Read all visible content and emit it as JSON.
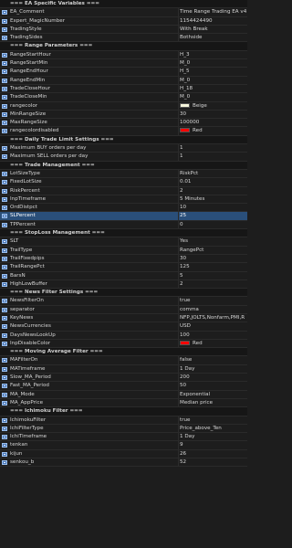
{
  "colors": {
    "beige": "#f5f5dc",
    "red": "#ff0000"
  },
  "rows": [
    {
      "type": "section",
      "name": "=== EA Specific Variables ===",
      "value": ""
    },
    {
      "type": "param",
      "name": "EA_Comment",
      "value": "Time Range Trading EA v4"
    },
    {
      "type": "param",
      "name": "Expert_MagicNumber",
      "value": "1154424490"
    },
    {
      "type": "param",
      "name": "TradingStyle",
      "value": "With Break"
    },
    {
      "type": "param",
      "name": "TradingSides",
      "value": "Bothside"
    },
    {
      "type": "section",
      "name": "=== Range Parameters ===",
      "value": ""
    },
    {
      "type": "param",
      "name": "RangeStartHour",
      "value": "H_3"
    },
    {
      "type": "param",
      "name": "RangeStartMin",
      "value": "M_0"
    },
    {
      "type": "param",
      "name": "RangeEndHour",
      "value": "H_5"
    },
    {
      "type": "param",
      "name": "RangeEndMin",
      "value": "M_0"
    },
    {
      "type": "param",
      "name": "TradeCloseHour",
      "value": "H_18"
    },
    {
      "type": "param",
      "name": "TradeCloseMin",
      "value": "M_0"
    },
    {
      "type": "param",
      "name": "rangecolor",
      "value": "Beige",
      "swatch": "beige"
    },
    {
      "type": "param",
      "name": "MinRangeSize",
      "value": "30"
    },
    {
      "type": "param",
      "name": "MaxRangeSize",
      "value": "100000"
    },
    {
      "type": "param",
      "name": "rangecolordisabled",
      "value": "Red",
      "swatch": "red"
    },
    {
      "type": "section",
      "name": "=== Daily Trade Limit Settings ===",
      "value": ""
    },
    {
      "type": "param",
      "name": "Maximum BUY orders per day",
      "value": "1"
    },
    {
      "type": "param",
      "name": "Maximum SELL orders per day",
      "value": "1"
    },
    {
      "type": "section",
      "name": "=== Trade Management ===",
      "value": ""
    },
    {
      "type": "param",
      "name": "LotSizeType",
      "value": "RiskPct"
    },
    {
      "type": "param",
      "name": "FixedLotSize",
      "value": "0.01"
    },
    {
      "type": "param",
      "name": "RiskPercent",
      "value": "2"
    },
    {
      "type": "param",
      "name": "InpTimeframe",
      "value": "5 Minutes"
    },
    {
      "type": "param",
      "name": "OrdDistpct",
      "value": "10"
    },
    {
      "type": "param",
      "name": "SLPercent",
      "value": "25",
      "selected": true
    },
    {
      "type": "param",
      "name": "TPPercent",
      "value": "0"
    },
    {
      "type": "section",
      "name": "=== StopLoss Management ===",
      "value": ""
    },
    {
      "type": "param",
      "name": "SLT",
      "value": "Yes"
    },
    {
      "type": "param",
      "name": "TrailType",
      "value": "RangePct"
    },
    {
      "type": "param",
      "name": "TrailFixedpips",
      "value": "30"
    },
    {
      "type": "param",
      "name": "TrailRangePct",
      "value": "125"
    },
    {
      "type": "param",
      "name": "BarsN",
      "value": "5"
    },
    {
      "type": "param",
      "name": "HighLowBuffer",
      "value": "2"
    },
    {
      "type": "section",
      "name": "=== News Filter Settings ===",
      "value": ""
    },
    {
      "type": "param",
      "name": "NewsFilterOn",
      "value": "true"
    },
    {
      "type": "param",
      "name": "separator",
      "value": "comma"
    },
    {
      "type": "param",
      "name": "KeyNews",
      "value": "NFP,JOLTS,Nonfarm,PMI,R"
    },
    {
      "type": "param",
      "name": "NewsCurrencies",
      "value": "USD"
    },
    {
      "type": "param",
      "name": "DaysNewsLookUp",
      "value": "100"
    },
    {
      "type": "param",
      "name": "InpDisableColor",
      "value": "Red",
      "swatch": "red"
    },
    {
      "type": "section",
      "name": "=== Moving Average Filter ===",
      "value": ""
    },
    {
      "type": "param",
      "name": "MAFilterOn",
      "value": "false"
    },
    {
      "type": "param",
      "name": "MATimeframe",
      "value": "1 Day"
    },
    {
      "type": "param",
      "name": "Slow_MA_Period",
      "value": "200"
    },
    {
      "type": "param",
      "name": "Fast_MA_Period",
      "value": "50"
    },
    {
      "type": "param",
      "name": "MA_Mode",
      "value": "Exponential"
    },
    {
      "type": "param",
      "name": "MA_AppPrice",
      "value": "Median price"
    },
    {
      "type": "section",
      "name": "=== Ichimoku Filter ===",
      "value": ""
    },
    {
      "type": "param",
      "name": "IchimokuFilter",
      "value": "true"
    },
    {
      "type": "param",
      "name": "IchiFilterType",
      "value": "Price_above_Ten"
    },
    {
      "type": "param",
      "name": "IchiTimeframe",
      "value": "1 Day"
    },
    {
      "type": "param",
      "name": "tenkan",
      "value": "9"
    },
    {
      "type": "param",
      "name": "kijun",
      "value": "26"
    },
    {
      "type": "param",
      "name": "senkou_b",
      "value": "52"
    }
  ]
}
